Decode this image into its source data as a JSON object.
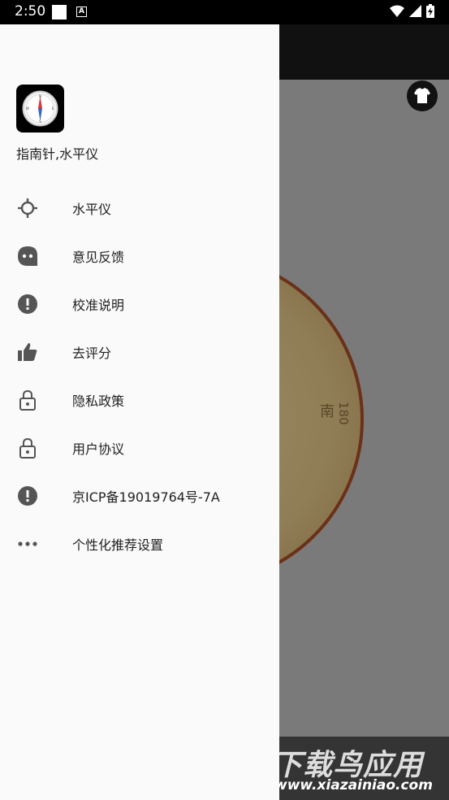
{
  "status_bar": {
    "time": "2:50"
  },
  "drawer": {
    "app_name": "指南针,水平仪",
    "items": [
      {
        "label": "水平仪",
        "icon": "crosshair-icon"
      },
      {
        "label": "意见反馈",
        "icon": "feedback-bubble-icon"
      },
      {
        "label": "校准说明",
        "icon": "alert-circle-icon"
      },
      {
        "label": "去评分",
        "icon": "thumbs-up-icon"
      },
      {
        "label": "隐私政策",
        "icon": "lock-icon"
      },
      {
        "label": "用户协议",
        "icon": "lock-icon"
      },
      {
        "label": "京ICP备19019764号-7A",
        "icon": "alert-circle-icon"
      },
      {
        "label": "个性化推荐设置",
        "icon": "more-dots-icon"
      }
    ]
  },
  "background": {
    "dial_direction": "南",
    "dial_degree": "180"
  },
  "watermark": {
    "title": "下载鸟应用",
    "url": "www.xiazainiao.com"
  },
  "colors": {
    "drawer_bg": "#fafafa",
    "scrim": "#7a7a7a",
    "icon": "#555555"
  }
}
